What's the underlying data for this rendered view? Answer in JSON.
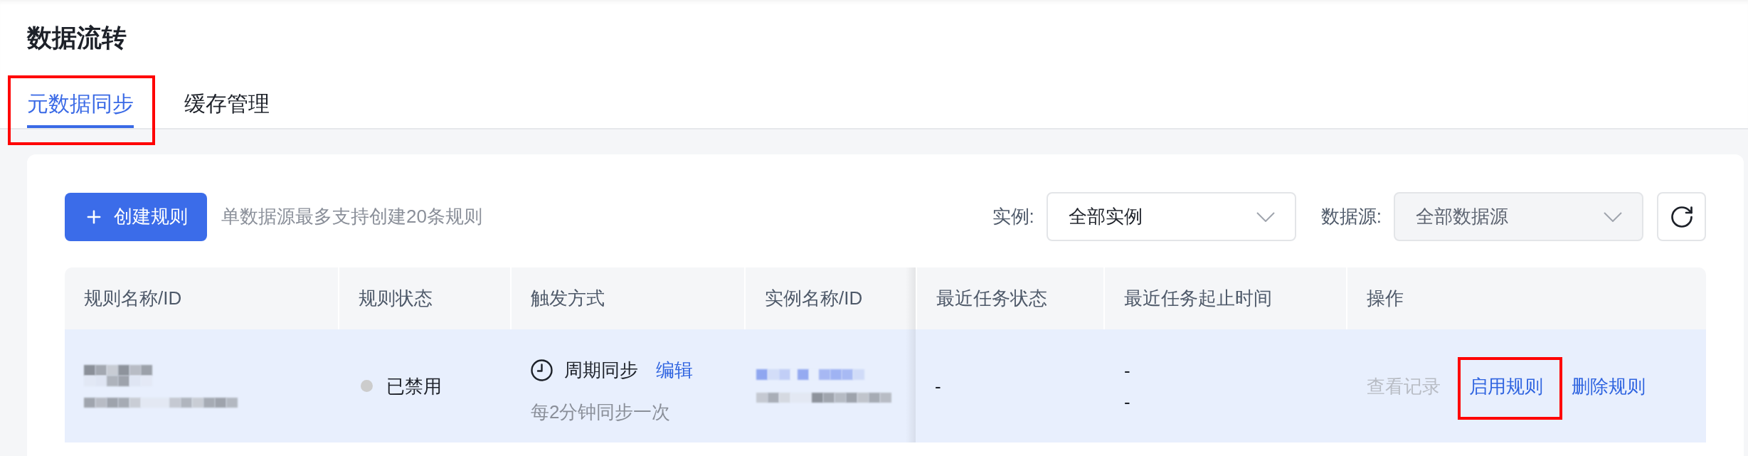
{
  "page": {
    "title": "数据流转"
  },
  "tabs": [
    {
      "label": "元数据同步",
      "selected": true,
      "highlighted": true
    },
    {
      "label": "缓存管理",
      "selected": false,
      "highlighted": false
    }
  ],
  "toolbar": {
    "create_button": "创建规则",
    "hint": "单数据源最多支持创建20条规则",
    "filters": [
      {
        "label": "实例:",
        "value": "全部实例",
        "disabled": false
      },
      {
        "label": "数据源:",
        "value": "全部数据源",
        "disabled": true
      }
    ]
  },
  "table": {
    "columns": [
      "规则名称/ID",
      "规则状态",
      "触发方式",
      "实例名称/ID",
      "最近任务状态",
      "最近任务起止时间",
      "操作"
    ],
    "rows": [
      {
        "selected": true,
        "status": {
          "label": "已禁用",
          "color": "#cccccc"
        },
        "trigger": {
          "mode": "周期同步",
          "edit": "编辑",
          "schedule": "每2分钟同步一次"
        },
        "last_task_status": "-",
        "last_task_time": [
          "-",
          "-"
        ],
        "actions": [
          {
            "label": "查看记录",
            "disabled": true,
            "highlighted": false
          },
          {
            "label": "启用规则",
            "disabled": false,
            "highlighted": true
          },
          {
            "label": "删除规则",
            "disabled": false,
            "highlighted": false
          }
        ]
      }
    ]
  }
}
